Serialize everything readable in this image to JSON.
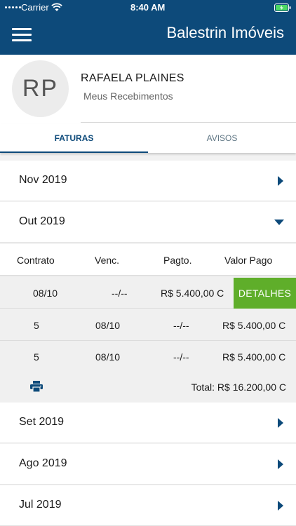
{
  "status_bar": {
    "carrier": "Carrier",
    "time": "8:40 AM"
  },
  "header": {
    "title": "Balestrin Imóveis",
    "menu_icon": "hamburger-menu-icon"
  },
  "profile": {
    "initials": "RP",
    "name": "RAFAELA PLAINES",
    "subtitle": "Meus Recebimentos"
  },
  "tabs": [
    {
      "label": "FATURAS",
      "active": true
    },
    {
      "label": "AVISOS",
      "active": false
    }
  ],
  "months": [
    {
      "label": "Nov 2019",
      "expanded": false
    },
    {
      "label": "Out 2019",
      "expanded": true
    },
    {
      "label": "Set 2019",
      "expanded": false
    },
    {
      "label": "Ago 2019",
      "expanded": false
    },
    {
      "label": "Jul 2019",
      "expanded": false
    }
  ],
  "table": {
    "headers": [
      "Contrato",
      "Venc.",
      "Pagto.",
      "Valor Pago"
    ],
    "rows": [
      {
        "c1": "08/10",
        "c2": "--/--",
        "value": "R$  5.400,00 C",
        "has_details": true
      },
      {
        "c1": "5",
        "c2": "08/10",
        "c3": "--/--",
        "value": "R$  5.400,00 C"
      },
      {
        "c1": "5",
        "c2": "08/10",
        "c3": "--/--",
        "value": "R$  5.400,00 C"
      }
    ],
    "details_label": "DETALHES",
    "total": "Total: R$  16.200,00 C"
  },
  "colors": {
    "primary": "#0d4a7a",
    "accent_green": "#5fae2a"
  }
}
